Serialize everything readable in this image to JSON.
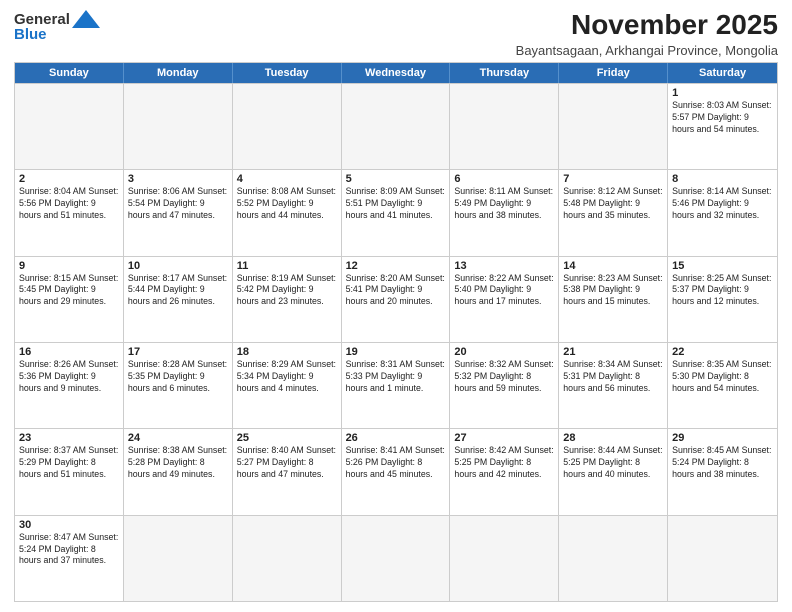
{
  "header": {
    "logo_general": "General",
    "logo_blue": "Blue",
    "month_year": "November 2025",
    "location": "Bayantsagaan, Arkhangai Province, Mongolia"
  },
  "days_of_week": [
    "Sunday",
    "Monday",
    "Tuesday",
    "Wednesday",
    "Thursday",
    "Friday",
    "Saturday"
  ],
  "weeks": [
    [
      {
        "day": "",
        "info": "",
        "empty": true
      },
      {
        "day": "",
        "info": "",
        "empty": true
      },
      {
        "day": "",
        "info": "",
        "empty": true
      },
      {
        "day": "",
        "info": "",
        "empty": true
      },
      {
        "day": "",
        "info": "",
        "empty": true
      },
      {
        "day": "",
        "info": "",
        "empty": true
      },
      {
        "day": "1",
        "info": "Sunrise: 8:03 AM\nSunset: 5:57 PM\nDaylight: 9 hours\nand 54 minutes.",
        "empty": false
      }
    ],
    [
      {
        "day": "2",
        "info": "Sunrise: 8:04 AM\nSunset: 5:56 PM\nDaylight: 9 hours\nand 51 minutes.",
        "empty": false
      },
      {
        "day": "3",
        "info": "Sunrise: 8:06 AM\nSunset: 5:54 PM\nDaylight: 9 hours\nand 47 minutes.",
        "empty": false
      },
      {
        "day": "4",
        "info": "Sunrise: 8:08 AM\nSunset: 5:52 PM\nDaylight: 9 hours\nand 44 minutes.",
        "empty": false
      },
      {
        "day": "5",
        "info": "Sunrise: 8:09 AM\nSunset: 5:51 PM\nDaylight: 9 hours\nand 41 minutes.",
        "empty": false
      },
      {
        "day": "6",
        "info": "Sunrise: 8:11 AM\nSunset: 5:49 PM\nDaylight: 9 hours\nand 38 minutes.",
        "empty": false
      },
      {
        "day": "7",
        "info": "Sunrise: 8:12 AM\nSunset: 5:48 PM\nDaylight: 9 hours\nand 35 minutes.",
        "empty": false
      },
      {
        "day": "8",
        "info": "Sunrise: 8:14 AM\nSunset: 5:46 PM\nDaylight: 9 hours\nand 32 minutes.",
        "empty": false
      }
    ],
    [
      {
        "day": "9",
        "info": "Sunrise: 8:15 AM\nSunset: 5:45 PM\nDaylight: 9 hours\nand 29 minutes.",
        "empty": false
      },
      {
        "day": "10",
        "info": "Sunrise: 8:17 AM\nSunset: 5:44 PM\nDaylight: 9 hours\nand 26 minutes.",
        "empty": false
      },
      {
        "day": "11",
        "info": "Sunrise: 8:19 AM\nSunset: 5:42 PM\nDaylight: 9 hours\nand 23 minutes.",
        "empty": false
      },
      {
        "day": "12",
        "info": "Sunrise: 8:20 AM\nSunset: 5:41 PM\nDaylight: 9 hours\nand 20 minutes.",
        "empty": false
      },
      {
        "day": "13",
        "info": "Sunrise: 8:22 AM\nSunset: 5:40 PM\nDaylight: 9 hours\nand 17 minutes.",
        "empty": false
      },
      {
        "day": "14",
        "info": "Sunrise: 8:23 AM\nSunset: 5:38 PM\nDaylight: 9 hours\nand 15 minutes.",
        "empty": false
      },
      {
        "day": "15",
        "info": "Sunrise: 8:25 AM\nSunset: 5:37 PM\nDaylight: 9 hours\nand 12 minutes.",
        "empty": false
      }
    ],
    [
      {
        "day": "16",
        "info": "Sunrise: 8:26 AM\nSunset: 5:36 PM\nDaylight: 9 hours\nand 9 minutes.",
        "empty": false
      },
      {
        "day": "17",
        "info": "Sunrise: 8:28 AM\nSunset: 5:35 PM\nDaylight: 9 hours\nand 6 minutes.",
        "empty": false
      },
      {
        "day": "18",
        "info": "Sunrise: 8:29 AM\nSunset: 5:34 PM\nDaylight: 9 hours\nand 4 minutes.",
        "empty": false
      },
      {
        "day": "19",
        "info": "Sunrise: 8:31 AM\nSunset: 5:33 PM\nDaylight: 9 hours\nand 1 minute.",
        "empty": false
      },
      {
        "day": "20",
        "info": "Sunrise: 8:32 AM\nSunset: 5:32 PM\nDaylight: 8 hours\nand 59 minutes.",
        "empty": false
      },
      {
        "day": "21",
        "info": "Sunrise: 8:34 AM\nSunset: 5:31 PM\nDaylight: 8 hours\nand 56 minutes.",
        "empty": false
      },
      {
        "day": "22",
        "info": "Sunrise: 8:35 AM\nSunset: 5:30 PM\nDaylight: 8 hours\nand 54 minutes.",
        "empty": false
      }
    ],
    [
      {
        "day": "23",
        "info": "Sunrise: 8:37 AM\nSunset: 5:29 PM\nDaylight: 8 hours\nand 51 minutes.",
        "empty": false
      },
      {
        "day": "24",
        "info": "Sunrise: 8:38 AM\nSunset: 5:28 PM\nDaylight: 8 hours\nand 49 minutes.",
        "empty": false
      },
      {
        "day": "25",
        "info": "Sunrise: 8:40 AM\nSunset: 5:27 PM\nDaylight: 8 hours\nand 47 minutes.",
        "empty": false
      },
      {
        "day": "26",
        "info": "Sunrise: 8:41 AM\nSunset: 5:26 PM\nDaylight: 8 hours\nand 45 minutes.",
        "empty": false
      },
      {
        "day": "27",
        "info": "Sunrise: 8:42 AM\nSunset: 5:25 PM\nDaylight: 8 hours\nand 42 minutes.",
        "empty": false
      },
      {
        "day": "28",
        "info": "Sunrise: 8:44 AM\nSunset: 5:25 PM\nDaylight: 8 hours\nand 40 minutes.",
        "empty": false
      },
      {
        "day": "29",
        "info": "Sunrise: 8:45 AM\nSunset: 5:24 PM\nDaylight: 8 hours\nand 38 minutes.",
        "empty": false
      }
    ],
    [
      {
        "day": "30",
        "info": "Sunrise: 8:47 AM\nSunset: 5:24 PM\nDaylight: 8 hours\nand 37 minutes.",
        "empty": false
      },
      {
        "day": "",
        "info": "",
        "empty": true
      },
      {
        "day": "",
        "info": "",
        "empty": true
      },
      {
        "day": "",
        "info": "",
        "empty": true
      },
      {
        "day": "",
        "info": "",
        "empty": true
      },
      {
        "day": "",
        "info": "",
        "empty": true
      },
      {
        "day": "",
        "info": "",
        "empty": true
      }
    ]
  ]
}
